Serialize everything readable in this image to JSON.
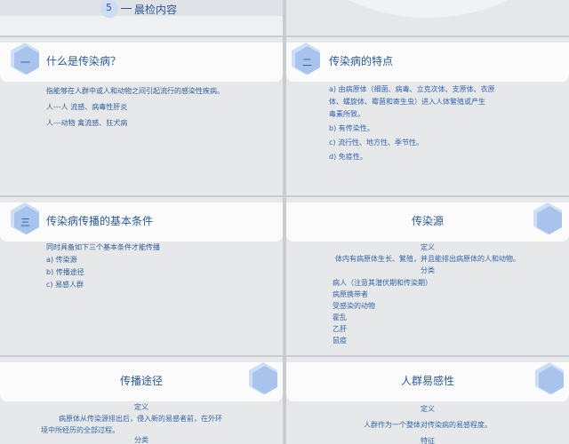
{
  "top": {
    "num": "5",
    "label": "晨检内容"
  },
  "p1": {
    "icon_label": "一",
    "title": "什么是传染病？",
    "desc": "指能够在人群中或人和动物之间引起流行的感染性疾病。",
    "line1": "人---人    流感、病毒性肝炎",
    "line2": "人---动物   禽流感、狂犬病"
  },
  "p2": {
    "icon_label": "二",
    "title": "传染病的特点",
    "items": [
      "a)   由病原体（细菌、病毒、立克次体、支原体、衣原",
      "       体、螺旋体、霉菌和寄生虫）进入人体繁殖或产生",
      "       毒素所致。",
      "b)   有传染性。",
      "c)   流行性、地方性、季节性。",
      "d)   免疫性。"
    ]
  },
  "p3": {
    "icon_label": "三",
    "title": "传染病传播的基本条件",
    "intro": "同时具备如下三个基本条件才能传播",
    "items": [
      "a)   传染源",
      "b)   传播途径",
      "c)   易感人群"
    ]
  },
  "p4": {
    "title": "传染源",
    "def_label": "定义",
    "def_text": "体内有病原体生长、繁殖，并且能排出病原体的人和动物。",
    "cls_label": "分类",
    "cls_items": [
      "病人（注意其潜伏期和传染期）",
      "病原携带者",
      "受感染的动物",
      "霍乱",
      "乙肝",
      "鼠疫"
    ]
  },
  "p5": {
    "title": "传播途径",
    "def_label": "定义",
    "def_line1": "病原体从传染源排出后，侵入新的易感者前，在外环",
    "def_line2": "境中所经历的全部过程。",
    "cls_label": "分类"
  },
  "p6": {
    "title": "人群易感性",
    "def_label": "定义",
    "def_text": "人群作为一个整体对传染病的易感程度。",
    "feat_label": "特征"
  },
  "colors": {
    "accent": "#2c5a96",
    "hex_fill": "#a9c4ec",
    "background": "#e7e8e9"
  }
}
